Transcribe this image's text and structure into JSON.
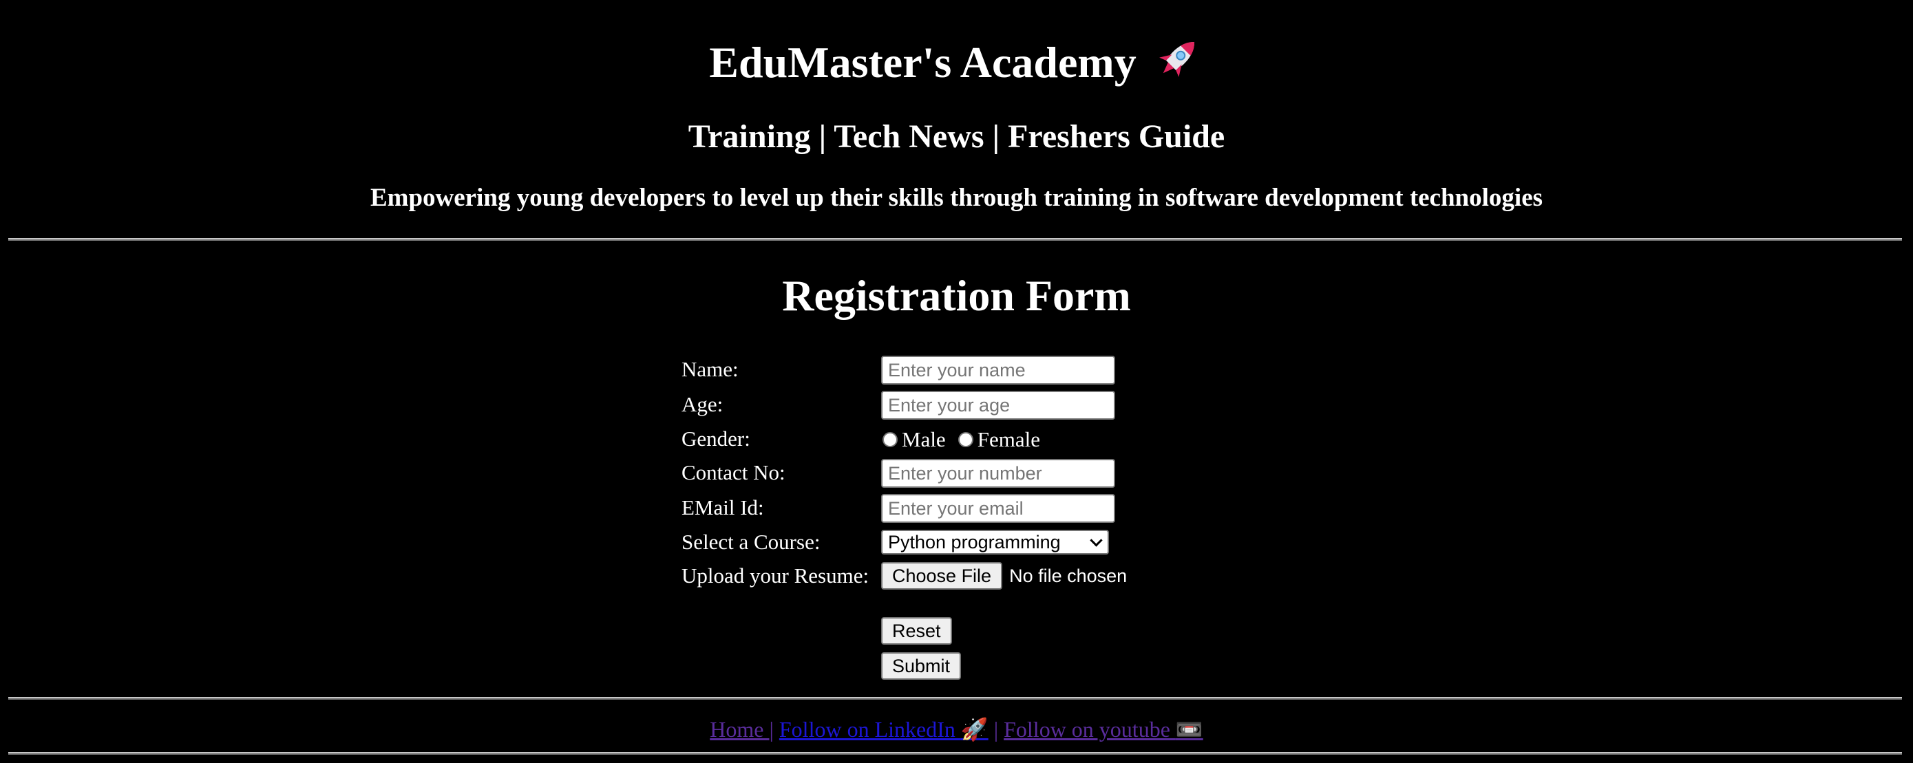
{
  "header": {
    "title": "EduMaster's Academy",
    "title_emoji": "🚀",
    "nav_subtitle": "Training | Tech News | Freshers Guide",
    "tagline": "Empowering young developers to level up their skills through training in software development technologies"
  },
  "form": {
    "title": "Registration Form",
    "name": {
      "label": "Name:",
      "placeholder": "Enter your name",
      "value": ""
    },
    "age": {
      "label": "Age:",
      "placeholder": "Enter your age",
      "value": ""
    },
    "gender": {
      "label": "Gender:",
      "options": [
        "Male",
        "Female"
      ],
      "selected": null
    },
    "contact": {
      "label": "Contact No:",
      "placeholder": "Enter your number",
      "value": ""
    },
    "email": {
      "label": "EMail Id:",
      "placeholder": "Enter your email",
      "value": ""
    },
    "course": {
      "label": "Select a Course:",
      "selected": "Python programming"
    },
    "resume": {
      "label": "Upload your Resume:",
      "button_label": "Choose File",
      "status": "No file chosen"
    },
    "reset_label": "Reset",
    "submit_label": "Submit"
  },
  "footer": {
    "home": "Home ",
    "separator": "|",
    "linkedin": "Follow on LinkedIn ",
    "linkedin_emoji": "🚀",
    "youtube": "Follow on youtube ",
    "youtube_emoji": "📼"
  },
  "colors": {
    "background": "#000000",
    "text": "#ffffff",
    "visited_link": "#5a2d9c",
    "unvisited_link": "#1c16d6"
  }
}
